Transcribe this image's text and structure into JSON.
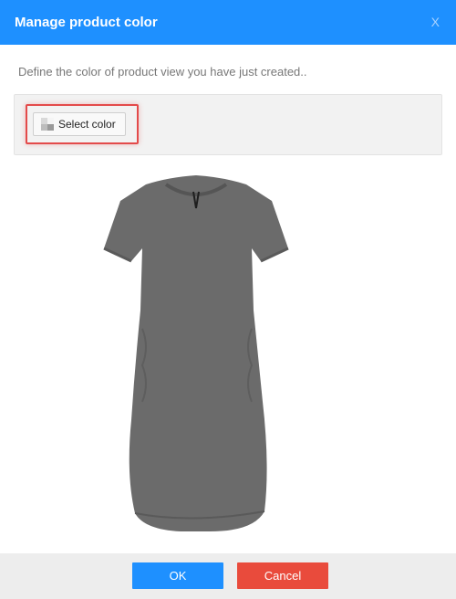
{
  "dialog": {
    "title": "Manage product color",
    "close_label": "X",
    "description": "Define the color of product view you have just created..",
    "toolbar": {
      "select_color_label": "Select color",
      "select_color_icon": "palette-icon"
    },
    "preview": {
      "image": "gray-tshirt-dress",
      "garment_color": "#6b6b6b"
    },
    "footer": {
      "ok_label": "OK",
      "cancel_label": "Cancel"
    }
  },
  "colors": {
    "title_bar": "#1e90ff",
    "ok_button": "#1e90ff",
    "cancel_button": "#e94b3c",
    "highlight": "#e34a4a"
  }
}
